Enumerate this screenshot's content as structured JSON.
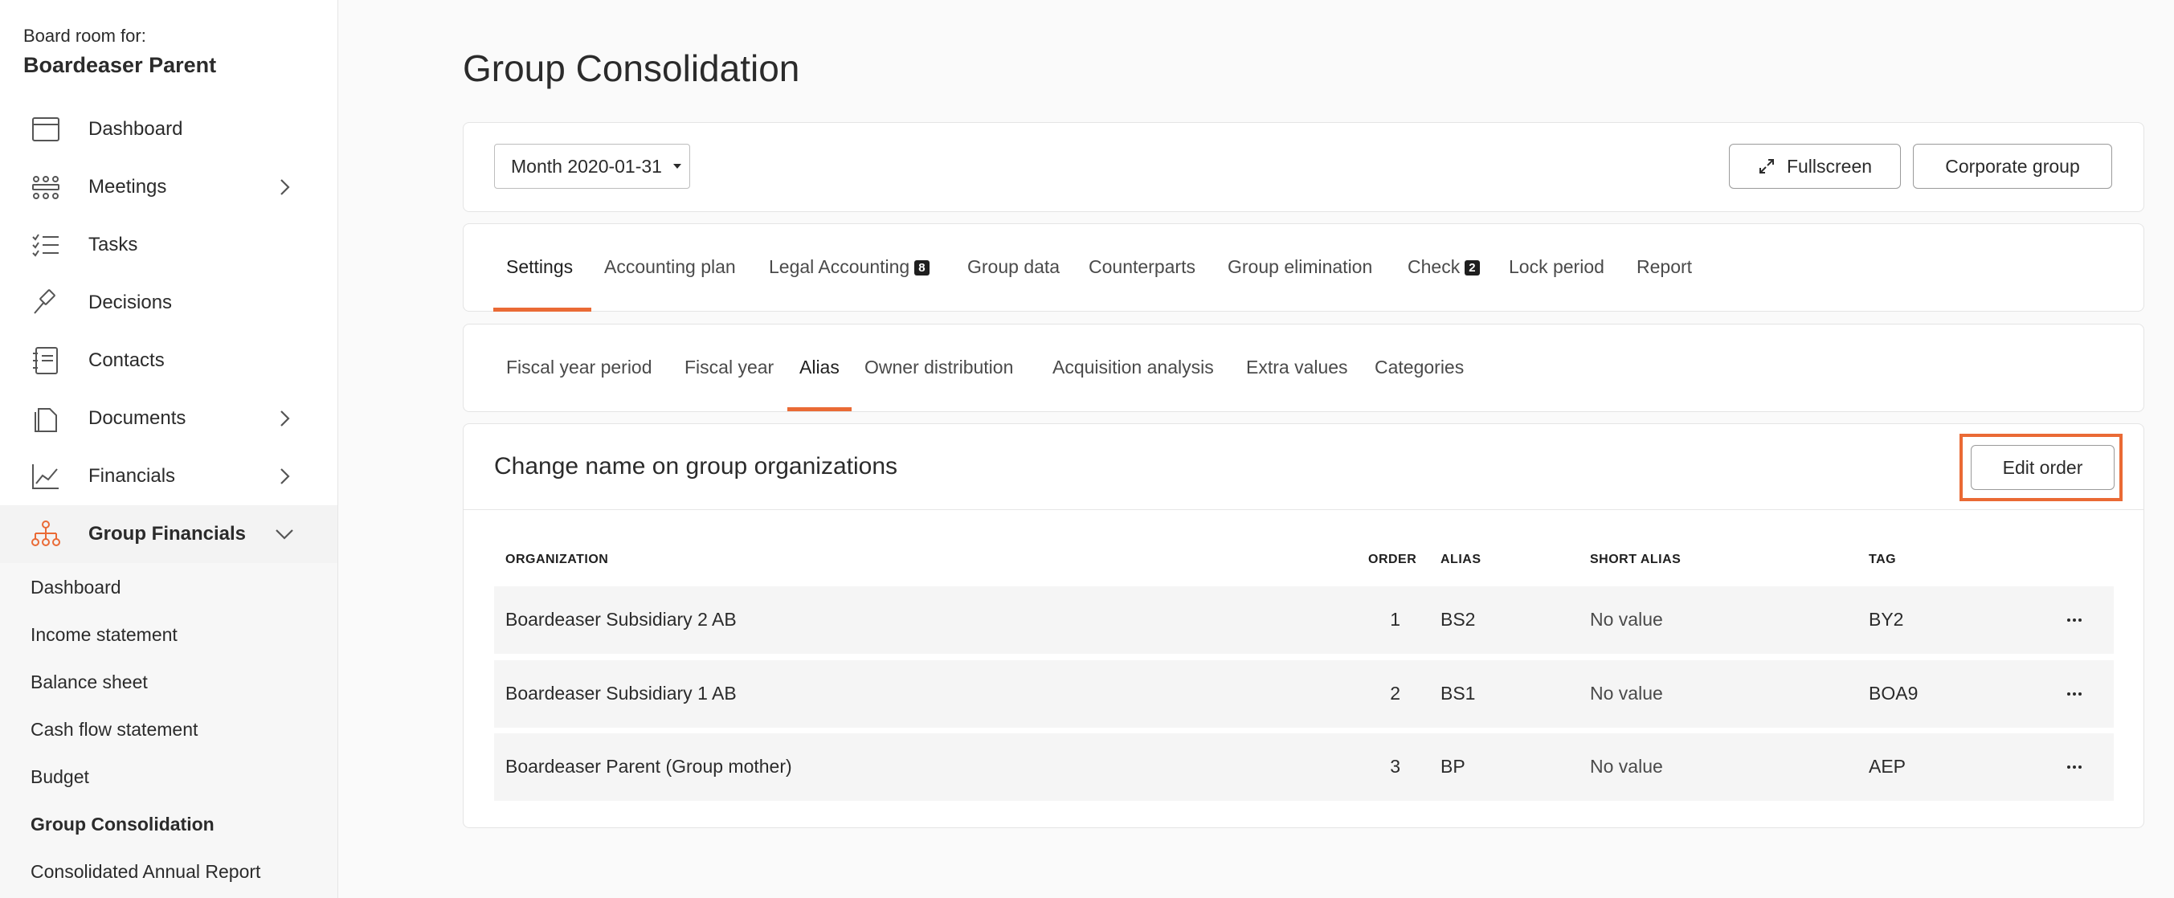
{
  "sidebar": {
    "board_label": "Board room for:",
    "board_name": "Boardeaser Parent",
    "items": [
      {
        "label": "Dashboard",
        "icon": "calendar-icon"
      },
      {
        "label": "Meetings",
        "icon": "meeting-icon"
      },
      {
        "label": "Tasks",
        "icon": "tasks-icon"
      },
      {
        "label": "Decisions",
        "icon": "gavel-icon"
      },
      {
        "label": "Contacts",
        "icon": "contacts-icon"
      },
      {
        "label": "Documents",
        "icon": "documents-icon"
      },
      {
        "label": "Financials",
        "icon": "chart-icon"
      },
      {
        "label": "Group Financials",
        "icon": "org-chart-icon"
      }
    ],
    "sub_items": [
      "Dashboard",
      "Income statement",
      "Balance sheet",
      "Cash flow statement",
      "Budget",
      "Group Consolidation",
      "Consolidated Annual Report"
    ]
  },
  "page": {
    "title": "Group Consolidation"
  },
  "toolbar": {
    "month": "Month 2020-01-31",
    "fullscreen_label": "Fullscreen",
    "corporate_label": "Corporate group"
  },
  "tabs": [
    {
      "label": "Settings",
      "badge": ""
    },
    {
      "label": "Accounting plan",
      "badge": ""
    },
    {
      "label": "Legal Accounting",
      "badge": "8"
    },
    {
      "label": "Group data",
      "badge": ""
    },
    {
      "label": "Counterparts",
      "badge": ""
    },
    {
      "label": "Group elimination",
      "badge": ""
    },
    {
      "label": "Check",
      "badge": "2"
    },
    {
      "label": "Lock period",
      "badge": ""
    },
    {
      "label": "Report",
      "badge": ""
    }
  ],
  "subtabs": [
    "Fiscal year period",
    "Fiscal year",
    "Alias",
    "Owner distribution",
    "Acquisition analysis",
    "Extra values",
    "Categories"
  ],
  "table": {
    "title": "Change name on group organizations",
    "edit_label": "Edit order",
    "headers": {
      "organization": "ORGANIZATION",
      "order": "ORDER",
      "alias": "ALIAS",
      "short_alias": "SHORT ALIAS",
      "tag": "TAG"
    },
    "rows": [
      {
        "organization": "Boardeaser Subsidiary 2 AB",
        "order": "1",
        "alias": "BS2",
        "short_alias": "No value",
        "tag": "BY2"
      },
      {
        "organization": "Boardeaser Subsidiary 1 AB",
        "order": "2",
        "alias": "BS1",
        "short_alias": "No value",
        "tag": "BOA9"
      },
      {
        "organization": "Boardeaser Parent (Group mother)",
        "order": "3",
        "alias": "BP",
        "short_alias": "No value",
        "tag": "AEP"
      }
    ]
  },
  "colors": {
    "accent": "#ea6a35"
  }
}
